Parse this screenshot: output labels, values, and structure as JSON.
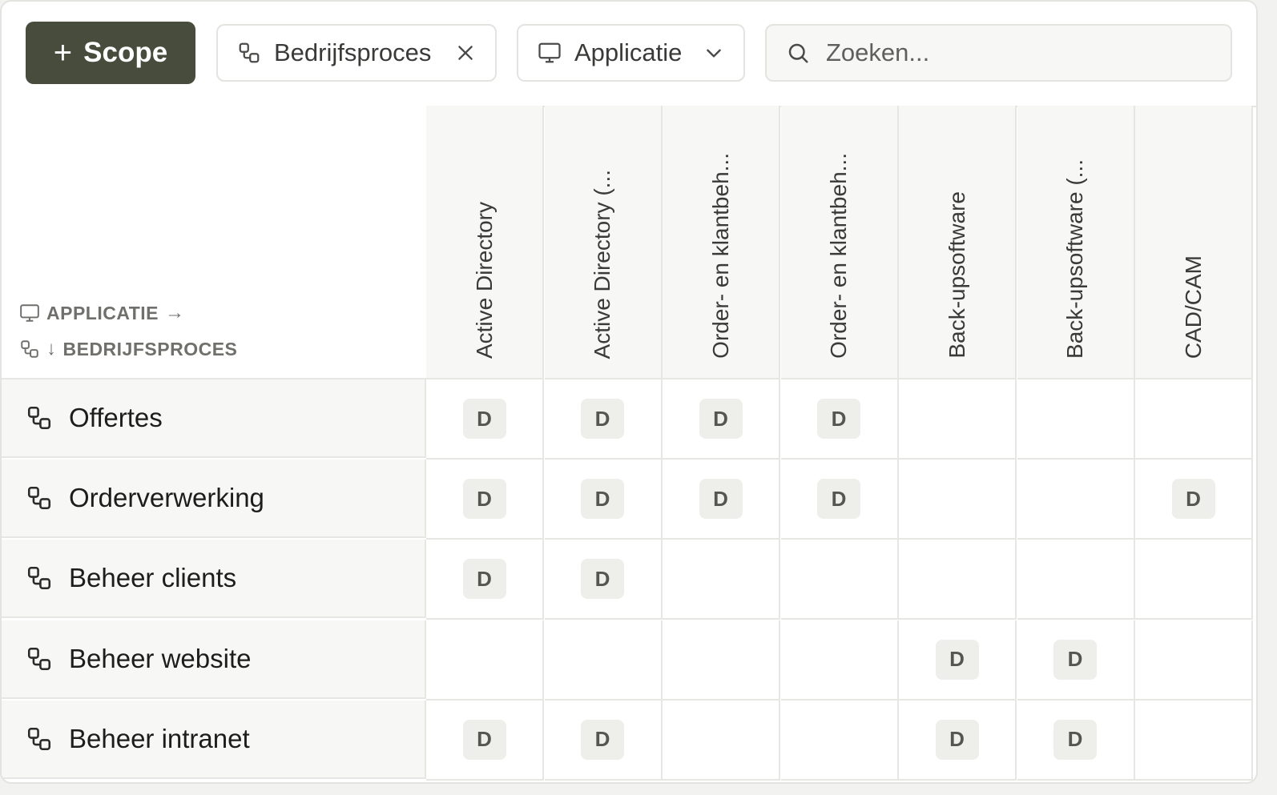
{
  "toolbar": {
    "scope_button": {
      "icon": "plus-icon",
      "label": "Scope"
    },
    "filter_chip": {
      "icon": "process-icon",
      "label": "Bedrijfsproces",
      "trail_icon": "close-icon"
    },
    "dimension_select": {
      "icon": "monitor-icon",
      "label": "Applicatie",
      "trail_icon": "chevron-down-icon"
    },
    "search": {
      "icon": "search-icon",
      "placeholder": "Zoeken...",
      "value": ""
    }
  },
  "matrix": {
    "axis_x_label": "APPLICATIE",
    "axis_y_label": "BEDRIJFSPROCES",
    "columns": [
      "Active Directory",
      "Active Directory (...",
      "Order- en klantbeh...",
      "Order- en klantbeh...",
      "Back-upsoftware",
      "Back-upsoftware (...",
      "CAD/CAM"
    ],
    "rows": [
      {
        "label": "Offertes",
        "cells": [
          "D",
          "D",
          "D",
          "D",
          "",
          "",
          ""
        ]
      },
      {
        "label": "Orderverwerking",
        "cells": [
          "D",
          "D",
          "D",
          "D",
          "",
          "",
          "D"
        ]
      },
      {
        "label": "Beheer clients",
        "cells": [
          "D",
          "D",
          "",
          "",
          "",
          "",
          ""
        ]
      },
      {
        "label": "Beheer website",
        "cells": [
          "",
          "",
          "",
          "",
          "D",
          "D",
          ""
        ]
      },
      {
        "label": "Beheer intranet",
        "cells": [
          "D",
          "D",
          "",
          "",
          "D",
          "D",
          ""
        ]
      }
    ]
  },
  "colors": {
    "primary_button": "#474c3c",
    "header_bg": "#f7f7f5",
    "badge_bg": "#eeeeea"
  }
}
